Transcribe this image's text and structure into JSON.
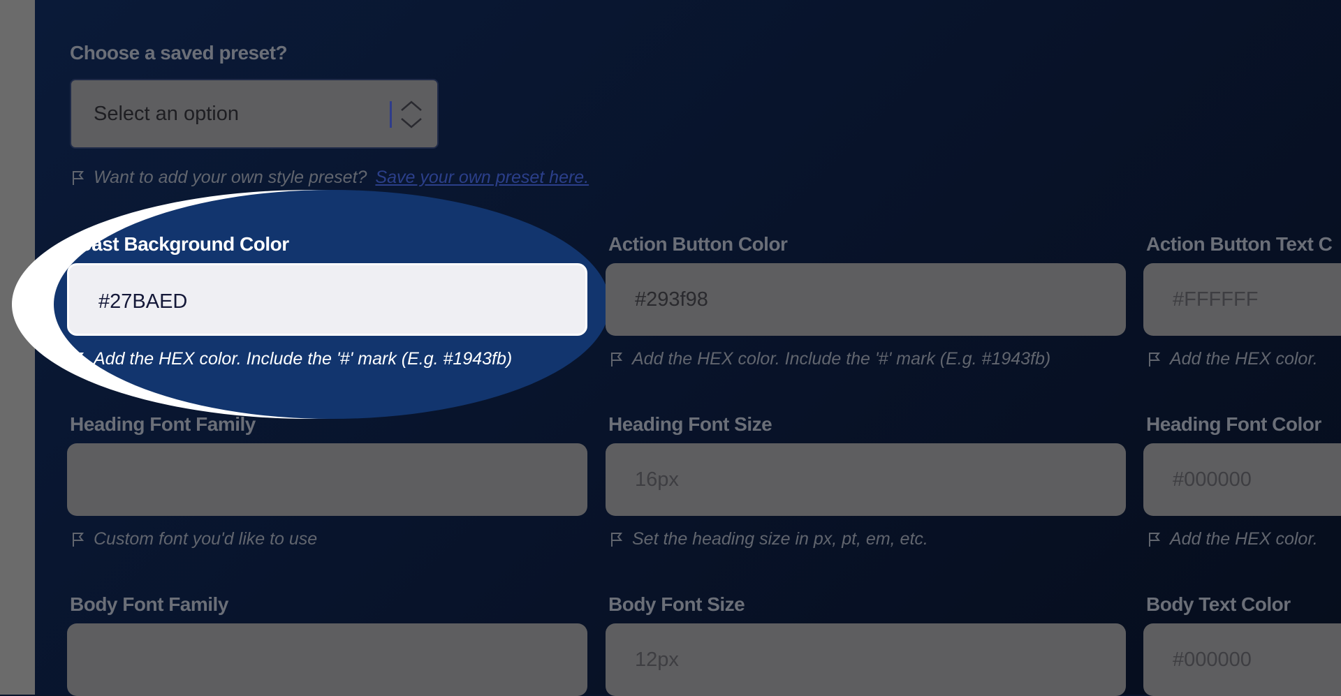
{
  "preset": {
    "label": "Choose a saved preset?",
    "select_value": "Select an option",
    "hint": "Want to add your own style preset?",
    "hint_link": "Save your own preset here."
  },
  "fields": [
    {
      "label": "Toast Background Color",
      "value": "#27BAED",
      "placeholder": "",
      "hint": "Add the HEX color. Include the '#' mark (E.g. #1943fb)"
    },
    {
      "label": "Action Button Color",
      "value": "#293f98",
      "placeholder": "",
      "hint": "Add the HEX color. Include the '#' mark (E.g. #1943fb)"
    },
    {
      "label": "Action Button Text C",
      "value": "",
      "placeholder": "#FFFFFF",
      "hint": "Add the HEX color."
    },
    {
      "label": "Heading Font Family",
      "value": "",
      "placeholder": "",
      "hint": "Custom font you'd like to use"
    },
    {
      "label": "Heading Font Size",
      "value": "",
      "placeholder": "16px",
      "hint": "Set the heading size in px, pt, em, etc."
    },
    {
      "label": "Heading Font Color",
      "value": "",
      "placeholder": "#000000",
      "hint": "Add the HEX color."
    },
    {
      "label": "Body Font Family",
      "value": "",
      "placeholder": "",
      "hint": ""
    },
    {
      "label": "Body Font Size",
      "value": "",
      "placeholder": "12px",
      "hint": ""
    },
    {
      "label": "Body Text Color",
      "value": "",
      "placeholder": "#000000",
      "hint": ""
    }
  ],
  "colors": {
    "highlight": "#12356e",
    "background": "#08142b",
    "link": "#2b3f8a"
  },
  "icons": {
    "hint": "flag-icon",
    "select": "chevron-up-down-icon"
  }
}
